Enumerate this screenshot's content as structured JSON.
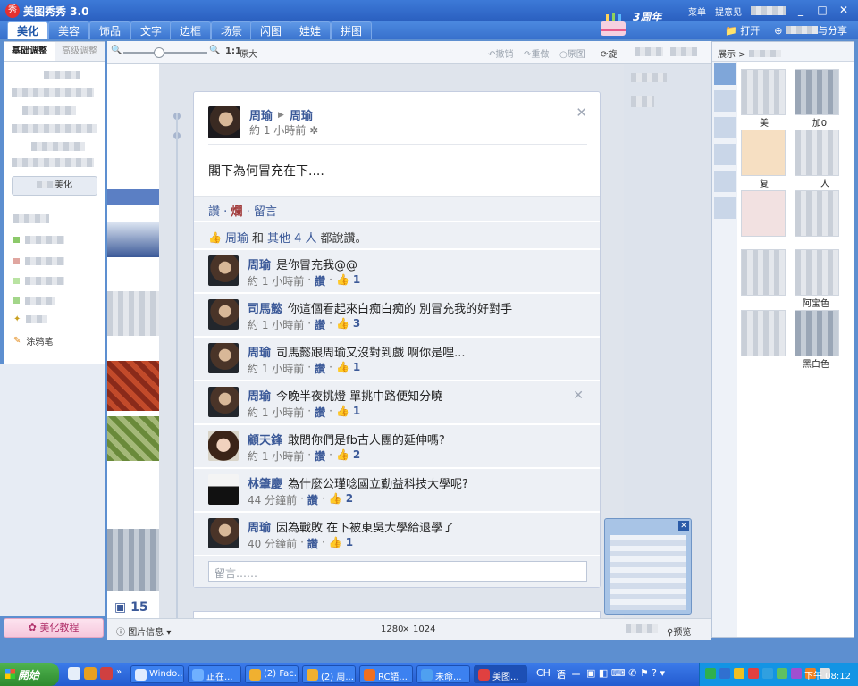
{
  "window": {
    "title": "美图秀秀 3.0",
    "logo": "秀",
    "anniversary": "3周年",
    "controls": [
      "_",
      "□",
      "✕"
    ]
  },
  "top_links": [
    "菜单",
    "提意见"
  ],
  "menu": {
    "tabs": [
      "美化",
      "美容",
      "饰品",
      "文字",
      "边框",
      "场景",
      "闪图",
      "娃娃",
      "拼图"
    ],
    "active": "美化",
    "open_label": "打开",
    "share_label": "与分享"
  },
  "toolbar": {
    "zoom_ratio": "1:1",
    "original": "原大",
    "undo": "撤销",
    "redo": "重做",
    "reset": "原图",
    "rotate": "旋"
  },
  "left_panel": {
    "tabs": [
      "基础调整",
      "高级调整"
    ],
    "button": "美化",
    "brush": "涂鸦笔",
    "tutorial": "美化教程"
  },
  "post": {
    "author": "周瑜",
    "target": "周瑜",
    "time": "約 1 小時前",
    "text": "閣下為何冒充在下....",
    "actions": [
      "讚",
      "爛",
      "留言"
    ],
    "likes_name": "周瑜",
    "likes_and": "和",
    "likes_others": "其他 4 人",
    "likes_suffix": "都說讚。",
    "comments": [
      {
        "name": "周瑜",
        "text": "是你冒充我@@",
        "time": "約 1 小時前",
        "like_label": "讚",
        "likes": "1",
        "avatar": "soldier"
      },
      {
        "name": "司馬懿",
        "text": "你這個看起來白痴白痴的 別冒充我的好對手",
        "time": "約 1 小時前",
        "like_label": "讚",
        "likes": "3",
        "avatar": "soldier"
      },
      {
        "name": "周瑜",
        "text": "司馬懿跟周瑜又沒對到戲 啊你是哩...",
        "time": "約 1 小時前",
        "like_label": "讚",
        "likes": "1",
        "avatar": "soldier"
      },
      {
        "name": "周瑜",
        "text": "今晚半夜挑燈 單挑中路便知分曉",
        "time": "約 1 小時前",
        "like_label": "讚",
        "likes": "1",
        "avatar": "soldier"
      },
      {
        "name": "顧天鋒",
        "text": "敢問你們是fb古人團的延伸嗎?",
        "time": "約 1 小時前",
        "like_label": "讚",
        "likes": "2",
        "avatar": "girl"
      },
      {
        "name": "林肇慶",
        "text": "為什麼公瑾唸國立勤益科技大學呢?",
        "time": "44 分鐘前",
        "like_label": "讚",
        "likes": "2",
        "avatar": "ninja"
      },
      {
        "name": "周瑜",
        "text": "因為戰敗 在下被東吳大學給退學了",
        "time": "40 分鐘前",
        "like_label": "讚",
        "likes": "1",
        "avatar": "soldier"
      }
    ],
    "reply_placeholder": "留言……"
  },
  "left_counter": "15",
  "right_panel": {
    "breadcrumb": "展示 >",
    "labels": [
      "美",
      "加0",
      "复",
      "人",
      "阿宝色",
      "黑白色"
    ]
  },
  "status": {
    "info": "图片信息",
    "width": "1280",
    "x": "×",
    "height": "1024",
    "preview": "预览"
  },
  "taskbar": {
    "start": "開始",
    "tasks": [
      "Windo...",
      "正在...",
      "(2) Fac...",
      "(2) 周...",
      "RC語...",
      "未命...",
      "美图..."
    ],
    "ime": [
      "CH",
      "语",
      "ー"
    ],
    "clock": "下午 08:12"
  }
}
